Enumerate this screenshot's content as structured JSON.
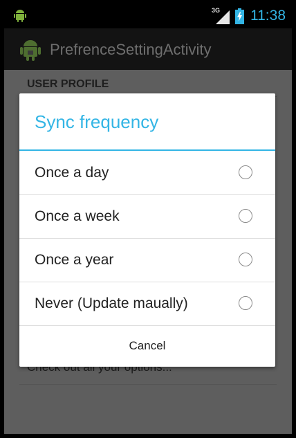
{
  "status_bar": {
    "network": "3G",
    "time": "11:38",
    "icons": [
      "android-icon",
      "signal-icon",
      "battery-charging-icon"
    ]
  },
  "action_bar": {
    "title": "PrefrenceSettingActivity",
    "icon": "android-app-icon"
  },
  "background": {
    "category": "USER PROFILE",
    "summary": "Check out all your options..."
  },
  "dialog": {
    "title": "Sync frequency",
    "options": [
      {
        "label": "Once a day",
        "selected": false
      },
      {
        "label": "Once a week",
        "selected": false
      },
      {
        "label": "Once a year",
        "selected": false
      },
      {
        "label": "Never (Update maually)",
        "selected": false
      }
    ],
    "cancel_label": "Cancel"
  },
  "colors": {
    "accent": "#33b5e5",
    "dialog_bg": "#ffffff",
    "dim_bg": "#5e5e5e"
  }
}
